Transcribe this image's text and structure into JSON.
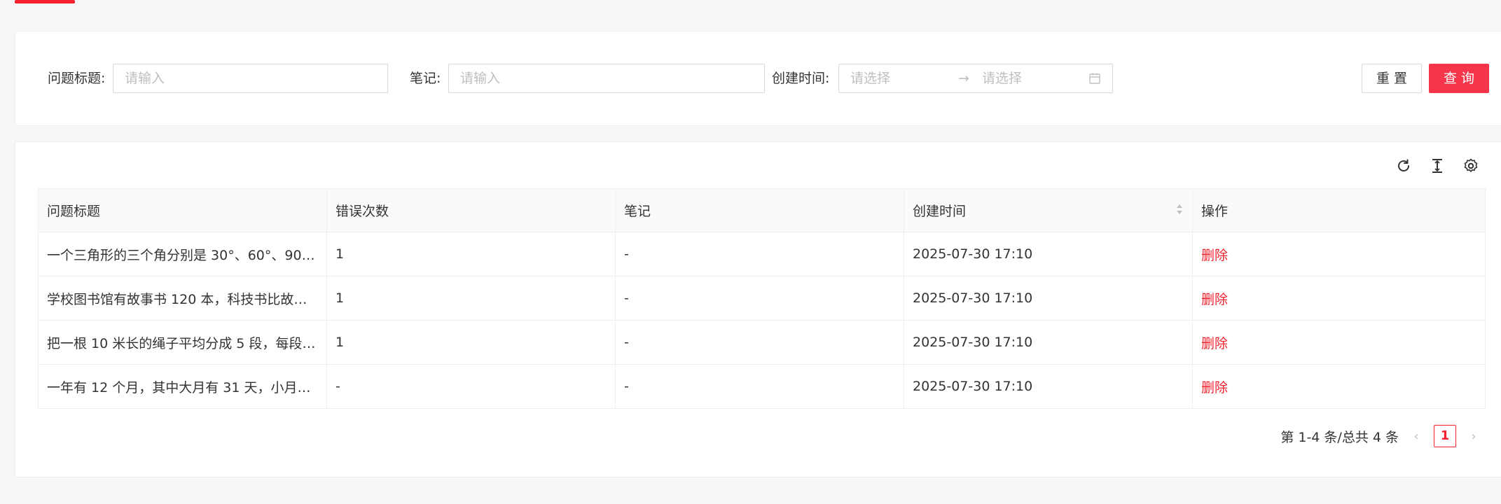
{
  "search": {
    "title_label": "问题标题:",
    "title_placeholder": "请输入",
    "note_label": "笔记:",
    "note_placeholder": "请输入",
    "time_label": "创建时间:",
    "time_start_placeholder": "请选择",
    "time_arrow": "→",
    "time_end_placeholder": "请选择",
    "reset_label": "重 置",
    "query_label": "查 询"
  },
  "toolbar": {
    "icons": [
      "refresh-icon",
      "column-height-icon",
      "setting-icon"
    ]
  },
  "table": {
    "headers": [
      "问题标题",
      "错误次数",
      "笔记",
      "创建时间",
      "操作"
    ],
    "rows": [
      {
        "title": "一个三角形的三个角分别是 30°、60°、90°，...",
        "errors": "1",
        "note": "-",
        "created": "2025-07-30 17:10",
        "action": "删除"
      },
      {
        "title": "学校图书馆有故事书 120 本，科技书比故事...",
        "errors": "1",
        "note": "-",
        "created": "2025-07-30 17:10",
        "action": "删除"
      },
      {
        "title": "把一根 10 米长的绳子平均分成 5 段，每段长...",
        "errors": "1",
        "note": "-",
        "created": "2025-07-30 17:10",
        "action": "删除"
      },
      {
        "title": "一年有 12 个月，其中大月有 31 天，小月有 ...",
        "errors": "-",
        "note": "-",
        "created": "2025-07-30 17:10",
        "action": "删除"
      }
    ]
  },
  "pagination": {
    "summary": "第 1-4 条/总共 4 条",
    "prev": "‹",
    "current": "1",
    "next": "›"
  },
  "colors": {
    "accent": "#f5364a",
    "danger_link": "#f5222d",
    "background": "#f6f7f9"
  }
}
